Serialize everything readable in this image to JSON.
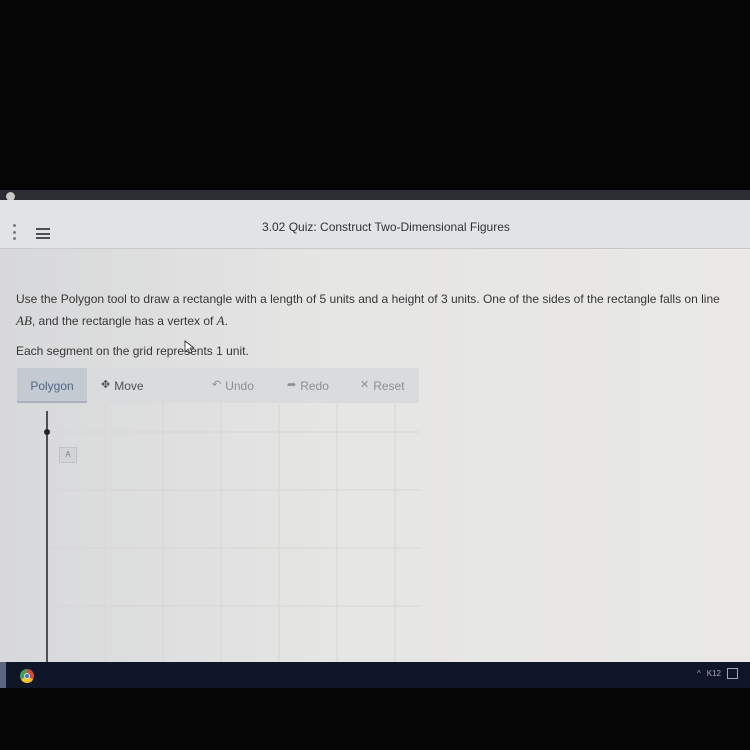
{
  "header": {
    "title": "3.02 Quiz: Construct Two-Dimensional Figures"
  },
  "question": {
    "line1_before": "Use the Polygon tool to draw a rectangle with a length of 5 units and a height of 3 units. One of the sides of the rectangle falls on ",
    "line_word": "line ",
    "line_name": "AB",
    "line1_after": ", and the rectangle has a vertex of ",
    "vertex": "A",
    "period": ".",
    "line2": "Each segment on the grid represents 1 unit."
  },
  "toolbar": {
    "polygon_label": "Polygon",
    "move_label": "Move",
    "undo_label": "Undo",
    "redo_label": "Redo",
    "reset_label": "Reset",
    "move_icon": "move-arrows-icon",
    "undo_icon": "undo-arrow-icon",
    "redo_icon": "redo-arrow-icon",
    "reset_icon": "close-x-icon"
  },
  "graph": {
    "point_label": "A"
  },
  "taskbar": {
    "tray_text": "K12"
  },
  "colors": {
    "polygon_active_bg": "#c4cad2",
    "polygon_active_text": "#4e6786",
    "page_bg": "#e6e6e4",
    "taskbar_bg": "#0e1628"
  }
}
